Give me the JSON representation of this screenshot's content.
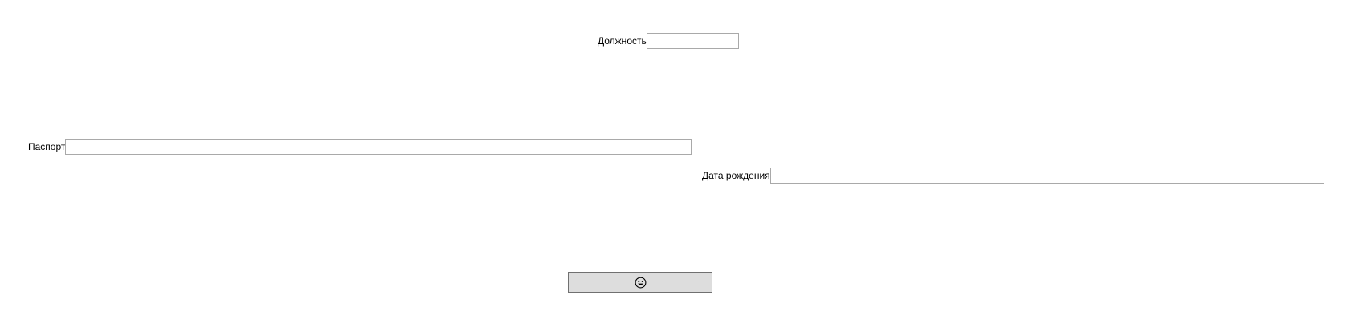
{
  "form": {
    "position": {
      "label": "Должность",
      "value": "",
      "placeholder": ""
    },
    "passport": {
      "label": "Паспорт",
      "value": "",
      "placeholder": ""
    },
    "birthdate": {
      "label": "Дата рождения",
      "value": "",
      "placeholder": ""
    },
    "submit_button": {
      "icon": "emoji-face-icon"
    }
  },
  "colors": {
    "background": "#ffffff",
    "input_border": "#a9a9a9",
    "button_background": "#dddddd",
    "button_border": "#707070"
  }
}
